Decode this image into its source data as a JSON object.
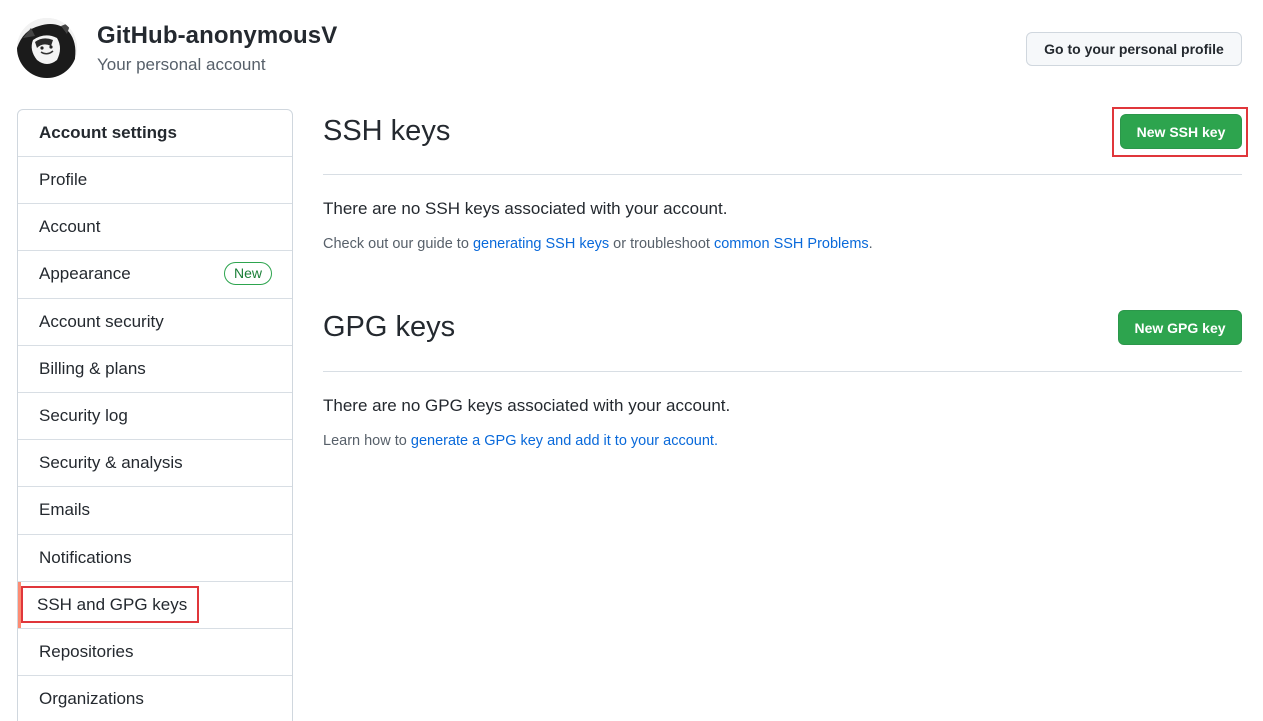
{
  "header": {
    "account_name": "GitHub-anonymousV",
    "account_subtitle": "Your personal account",
    "profile_button": "Go to your personal profile"
  },
  "sidebar": {
    "heading": "Account settings",
    "items": [
      {
        "label": "Profile"
      },
      {
        "label": "Account"
      },
      {
        "label": "Appearance",
        "badge": "New"
      },
      {
        "label": "Account security"
      },
      {
        "label": "Billing & plans"
      },
      {
        "label": "Security log"
      },
      {
        "label": "Security & analysis"
      },
      {
        "label": "Emails"
      },
      {
        "label": "Notifications"
      },
      {
        "label": "SSH and GPG keys",
        "selected": true
      },
      {
        "label": "Repositories"
      },
      {
        "label": "Organizations"
      }
    ]
  },
  "ssh": {
    "title": "SSH keys",
    "button": "New SSH key",
    "empty_message": "There are no SSH keys associated with your account.",
    "help_prefix": "Check out our guide to ",
    "help_link1": "generating SSH keys",
    "help_middle": " or troubleshoot ",
    "help_link2": "common SSH Problems",
    "help_suffix": "."
  },
  "gpg": {
    "title": "GPG keys",
    "button": "New GPG key",
    "empty_message": "There are no GPG keys associated with your account.",
    "help_prefix": "Learn how to ",
    "help_link": "generate a GPG key and add it to your account",
    "help_suffix": "."
  },
  "colors": {
    "primary_button": "#2da44e",
    "link": "#0969da",
    "highlight": "#e0363b",
    "selected_indicator": "#fd8c73"
  }
}
